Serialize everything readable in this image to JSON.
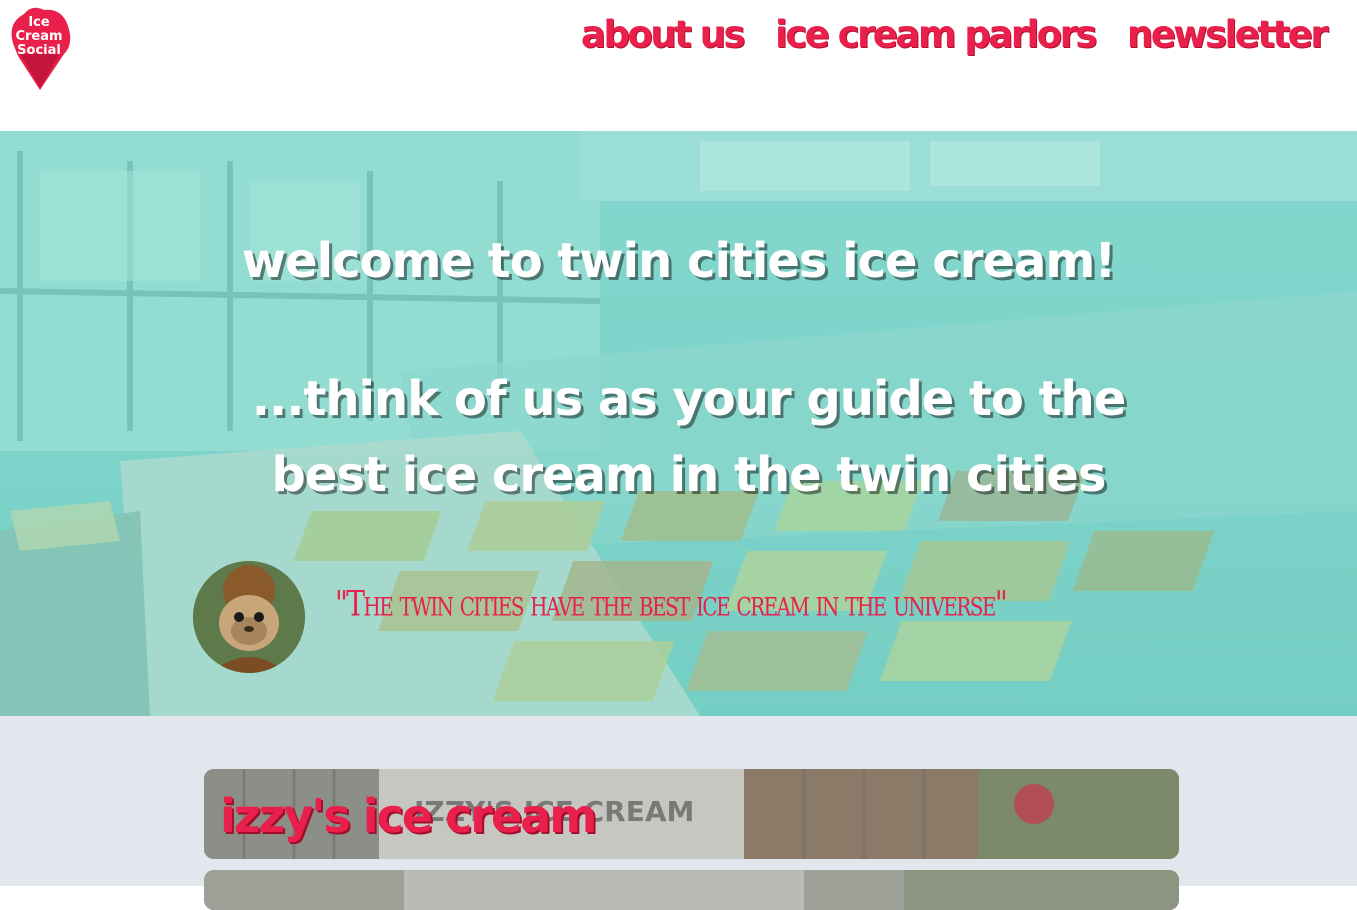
{
  "brand": {
    "logo_text": [
      "Ice",
      "Cream",
      "Social"
    ],
    "accent_color": "#e8204b"
  },
  "nav": {
    "items": [
      {
        "label": "about us"
      },
      {
        "label": "ice cream parlors"
      },
      {
        "label": "newsletter"
      }
    ]
  },
  "hero": {
    "title": "welcome to twin cities ice cream!",
    "subtitle": "...think of us as your guide to the best ice cream in the twin cities",
    "quote": "\"The twin cities have the best ice cream in the universe\""
  },
  "parlors": [
    {
      "name": "izzy's ice cream",
      "sign_text": "IZZY'S ICE CREAM"
    }
  ]
}
